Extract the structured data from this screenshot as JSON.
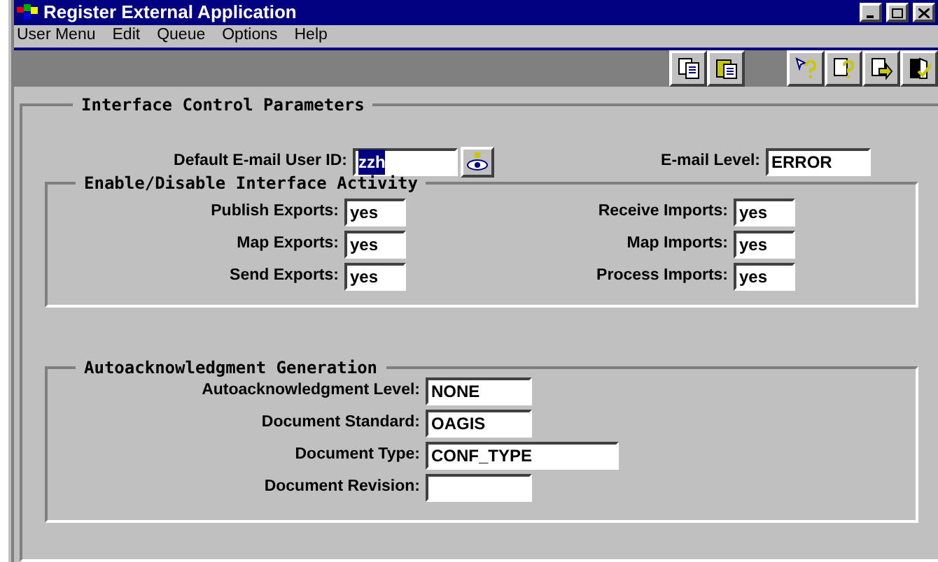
{
  "window": {
    "title": "Register External Application"
  },
  "menu": [
    {
      "label": "User Menu"
    },
    {
      "label": "Edit"
    },
    {
      "label": "Queue"
    },
    {
      "label": "Options"
    },
    {
      "label": "Help"
    }
  ],
  "main_group": {
    "title": "Interface Control Parameters",
    "user_id": {
      "label": "Default E-mail User ID:",
      "value": "zzh",
      "text_selected": true
    },
    "email_level": {
      "label": "E-mail Level:",
      "value": "ERROR"
    }
  },
  "activity_group": {
    "title": "Enable/Disable Interface Activity",
    "left": [
      {
        "label": "Publish Exports:",
        "value": "yes"
      },
      {
        "label": "Map Exports:",
        "value": "yes"
      },
      {
        "label": "Send Exports:",
        "value": "yes"
      }
    ],
    "right": [
      {
        "label": "Receive Imports:",
        "value": "yes"
      },
      {
        "label": "Map Imports:",
        "value": "yes"
      },
      {
        "label": "Process Imports:",
        "value": "yes"
      }
    ]
  },
  "ack_group": {
    "title": "Autoacknowledgment Generation",
    "fields": [
      {
        "label": "Autoacknowledgment Level:",
        "value": "NONE",
        "kind": "short"
      },
      {
        "label": "Document Standard:",
        "value": "OAGIS",
        "kind": "short"
      },
      {
        "label": "Document Type:",
        "value": "CONF_TYPE",
        "kind": "long"
      },
      {
        "label": "Document Revision:",
        "kind": "short"
      }
    ]
  }
}
